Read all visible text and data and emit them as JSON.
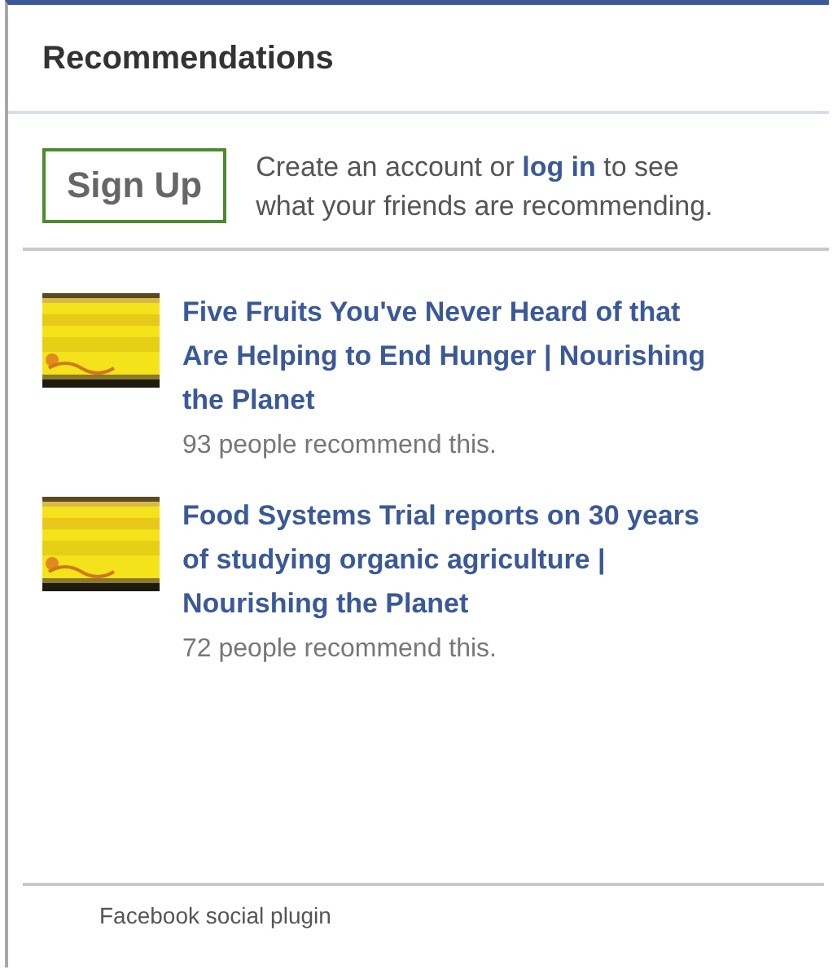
{
  "header": {
    "title": "Recommendations"
  },
  "signup": {
    "button": "Sign Up",
    "text_before": "Create an account or",
    "link": "log in",
    "text_after": "to see what your friends are recommending."
  },
  "items": [
    {
      "kind": "picture",
      "title": "Five Fruits You've Never Heard of that Are Helping to End Hunger | Nourishing the Planet",
      "count": "93 people recommend this."
    },
    {
      "kind": "picture",
      "title": "Food Systems Trial reports on 30 years of studying organic agriculture | Nourishing the Planet",
      "count": "72 people recommend this."
    }
  ],
  "footer": {
    "text": "Facebook social plugin"
  }
}
